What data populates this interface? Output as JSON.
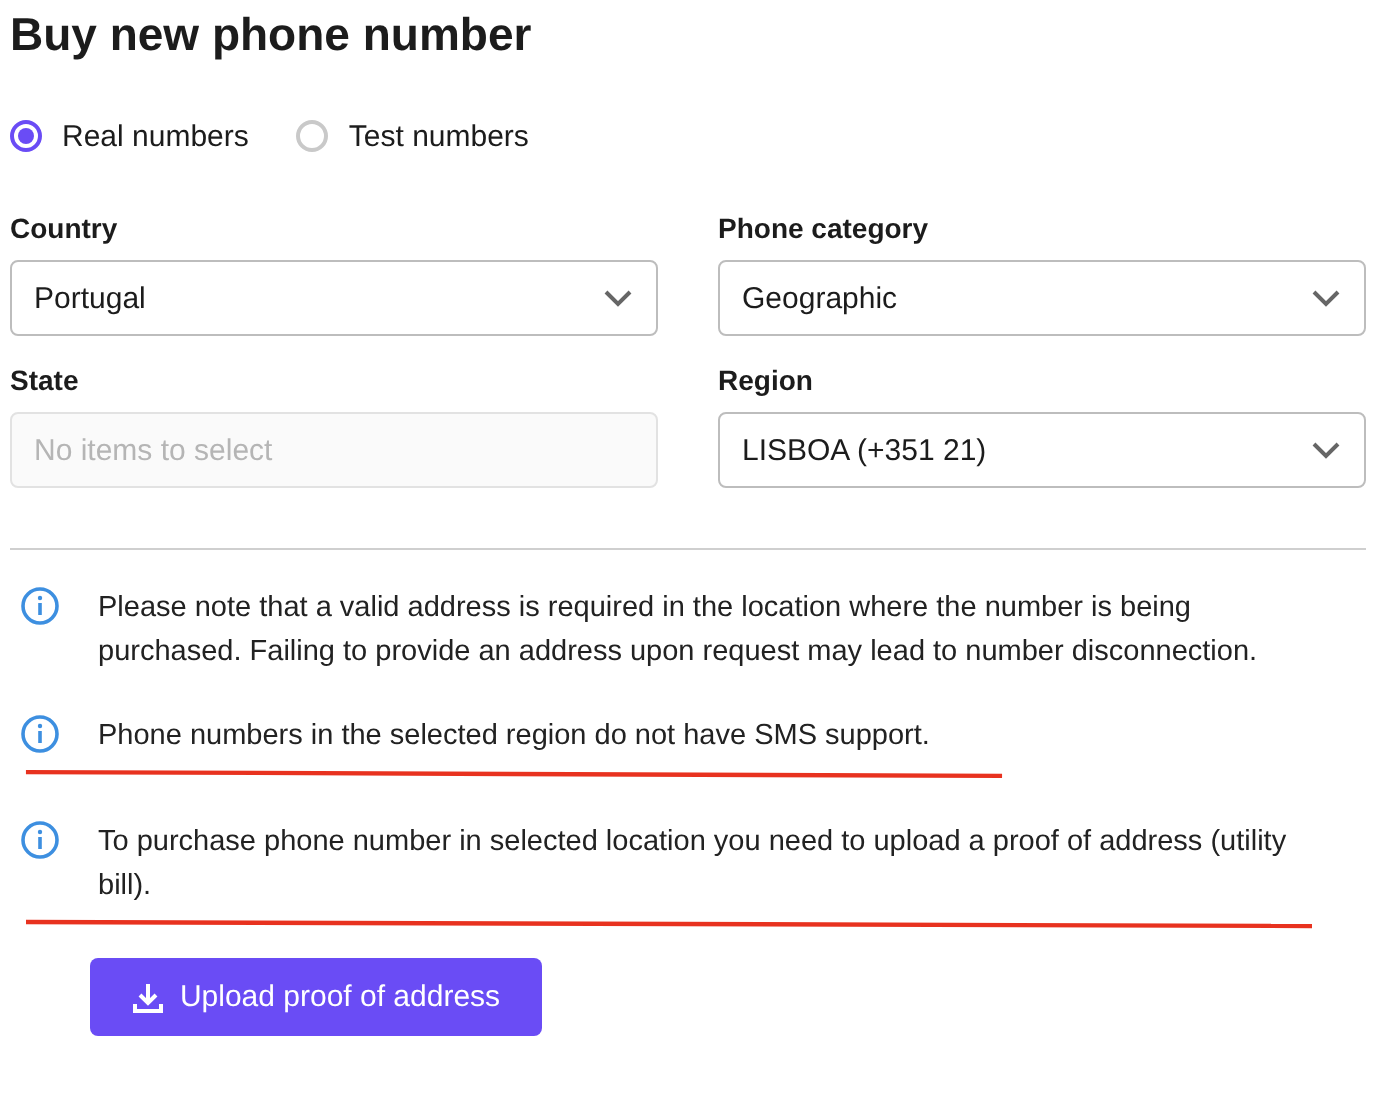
{
  "title": "Buy new phone number",
  "number_types": [
    {
      "label": "Real numbers",
      "selected": true
    },
    {
      "label": "Test numbers",
      "selected": false
    }
  ],
  "fields": [
    {
      "label": "Country",
      "value": "Portugal",
      "disabled": false
    },
    {
      "label": "Phone category",
      "value": "Geographic",
      "disabled": false
    },
    {
      "label": "State",
      "placeholder": "No items to select",
      "disabled": true
    },
    {
      "label": "Region",
      "value": "LISBOA (+351 21)",
      "disabled": false
    }
  ],
  "notes": [
    {
      "text": "Please note that a valid address is required in the location where the number is being purchased. Failing to provide an address upon request may lead to number disconnection.",
      "underlined": false
    },
    {
      "text": "Phone numbers in the selected region do not have SMS support.",
      "underlined": true
    },
    {
      "text": "To purchase phone number in selected location you need to upload a proof of address (utility bill).",
      "underlined": true
    }
  ],
  "upload_button": "Upload proof of address"
}
